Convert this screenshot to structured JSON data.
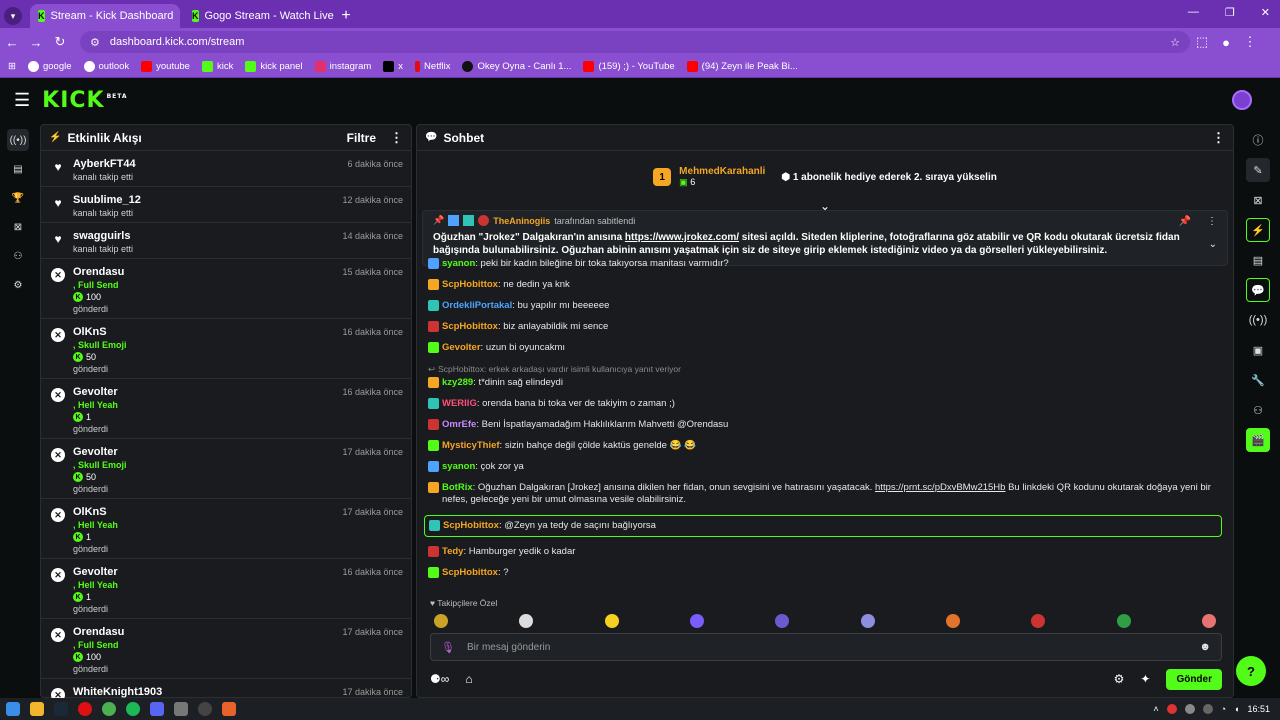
{
  "browser": {
    "tabs": [
      {
        "title": "Stream - Kick Dashboard",
        "active": true
      },
      {
        "title": "Gogo Stream - Watch Live on Kick",
        "active": false
      }
    ],
    "new_tab": "+",
    "url": "dashboard.kick.com/stream",
    "bookmarks": [
      {
        "label": "google",
        "color": "#ffffff"
      },
      {
        "label": "outlook",
        "color": "#ffffff"
      },
      {
        "label": "youtube",
        "color": "#ff0000"
      },
      {
        "label": "kick",
        "color": "#53fc18"
      },
      {
        "label": "kick panel",
        "color": "#53fc18"
      },
      {
        "label": "instagram",
        "color": "#e1306c"
      },
      {
        "label": "x",
        "color": "#000000"
      },
      {
        "label": "Netflix",
        "color": "#e50914"
      },
      {
        "label": "Okey Oyna - Canlı 1...",
        "color": "#111111"
      },
      {
        "label": "(159) ;) - YouTube",
        "color": "#ff0000"
      },
      {
        "label": "(94) Zeyn ile Peak Bi...",
        "color": "#ff0000"
      }
    ]
  },
  "kick": {
    "logo": "KICK",
    "beta": "BETA",
    "accent": "#53fc18"
  },
  "activity": {
    "title": "Etkinlik Akışı",
    "filter": "Filtre",
    "events": [
      {
        "icon": "heart",
        "name": "AyberkFT44",
        "sub": "kanalı takip etti",
        "time": "6 dakika önce"
      },
      {
        "icon": "heart",
        "name": "Suublime_12",
        "sub": "kanalı takip etti",
        "time": "12 dakika önce"
      },
      {
        "icon": "heart",
        "name": "swagguirls",
        "sub": "kanalı takip etti",
        "time": "14 dakika önce"
      },
      {
        "icon": "kick",
        "name": "Orendasu",
        "gift": ", Full Send",
        "amount": "100",
        "sub": "gönderdi",
        "time": "15 dakika önce"
      },
      {
        "icon": "kick",
        "name": "OlKnS",
        "gift": ", Skull Emoji",
        "amount": "50",
        "sub": "gönderdi",
        "time": "16 dakika önce"
      },
      {
        "icon": "kick",
        "name": "Gevolter",
        "gift": ", Hell Yeah",
        "amount": "1",
        "sub": "gönderdi",
        "time": "16 dakika önce"
      },
      {
        "icon": "kick",
        "name": "Gevolter",
        "gift": ", Skull Emoji",
        "amount": "50",
        "sub": "gönderdi",
        "time": "17 dakika önce"
      },
      {
        "icon": "kick",
        "name": "OlKnS",
        "gift": ", Hell Yeah",
        "amount": "1",
        "sub": "gönderdi",
        "time": "17 dakika önce"
      },
      {
        "icon": "kick",
        "name": "Gevolter",
        "gift": ", Hell Yeah",
        "amount": "1",
        "sub": "gönderdi",
        "time": "16 dakika önce"
      },
      {
        "icon": "kick",
        "name": "Orendasu",
        "gift": ", Full Send",
        "amount": "100",
        "sub": "gönderdi",
        "time": "17 dakika önce"
      },
      {
        "icon": "kick",
        "name": "WhiteKnight1903",
        "time": "17 dakika önce"
      }
    ]
  },
  "chat": {
    "title": "Sohbet",
    "top_gifter": {
      "rank": "1",
      "name": "MehmedKarahanli",
      "count": "6",
      "message": "1 abonelik hediye ederek 2. sıraya yükselin"
    },
    "pinned": {
      "by": "TheAninogiis",
      "by_suffix": "tarafından sabitlendi",
      "text_before": "Oğuzhan \"Jrokez\" Dalgakıran'ın anısına ",
      "link": "https://www.jrokez.com/",
      "text_after": " sitesi açıldı. Siteden kliplerine, fotoğraflarına göz atabilir ve QR kodu okutarak ücretsiz fidan bağışında bulunabilirsiniz. Oğuzhan abinin anısını yaşatmak için siz de siteye girip eklemek istediğiniz video ya da görselleri yükleyebilirsiniz."
    },
    "messages": [
      {
        "user": "syanon",
        "color": "#53fc18",
        "text": "peki bir kadın bileğine bir toka takıyorsa manitası varmıdır?"
      },
      {
        "user": "ScpHobittox",
        "color": "#f5a623",
        "text": "ne dedin ya knk"
      },
      {
        "user": "OrdekliPortakal",
        "color": "#4fa3ff",
        "text": "bu yapılır mı beeeeee"
      },
      {
        "user": "ScpHobittox",
        "color": "#f5a623",
        "text": "biz anlayabildik mi sence"
      },
      {
        "user": "Gevolter",
        "color": "#f5a623",
        "text": "uzun bi oyuncakmı"
      },
      {
        "reply": "ScpHobittox: erkek arkadaşı vardır isimli kullanıcıya yanıt veriyor"
      },
      {
        "user": "kzy289",
        "color": "#53fc18",
        "text": "t*dinin sağ elindeydi"
      },
      {
        "user": "WERIIG",
        "color": "#ff4f7b",
        "text": "orenda bana bi toka ver de takiyim o zaman ;)"
      },
      {
        "user": "OmrEfe",
        "color": "#c58bff",
        "text": "Beni İspatlayamadağım Haklılıklarım Mahvetti @Orendasu"
      },
      {
        "user": "MysticyThief",
        "color": "#f5a623",
        "text": "sizin bahçe değil çölde kaktüs genelde 😂 😂"
      },
      {
        "user": "syanon",
        "color": "#53fc18",
        "text": "çok zor ya"
      },
      {
        "user": "BotRix",
        "color": "#53fc18",
        "text": "Oğuzhan Dalgakıran [Jrokez] anısına dikilen her fidan, onun sevgisini ve hatırasını yaşatacak.",
        "link": "https://prnt.sc/pDxvBMw215Hb",
        "text2": "Bu linkdeki QR kodunu okutarak doğaya yeni bir nefes, geleceğe yeni bir umut olmasına vesile olabilirsiniz."
      },
      {
        "user": "ScpHobittox",
        "color": "#f5a623",
        "text": "@Zeyn ya tedy de saçını bağlıyorsa",
        "highlight": true
      },
      {
        "user": "Tedy",
        "color": "#f5a623",
        "text": "Hamburger yedik o kadar"
      },
      {
        "user": "ScpHobittox",
        "color": "#f5a623",
        "text": "?"
      }
    ],
    "emote_label": "Takipçilere Özel",
    "input_placeholder": "Bir mesaj gönderin",
    "send": "Gönder"
  },
  "taskbar": {
    "time": "16:51"
  }
}
